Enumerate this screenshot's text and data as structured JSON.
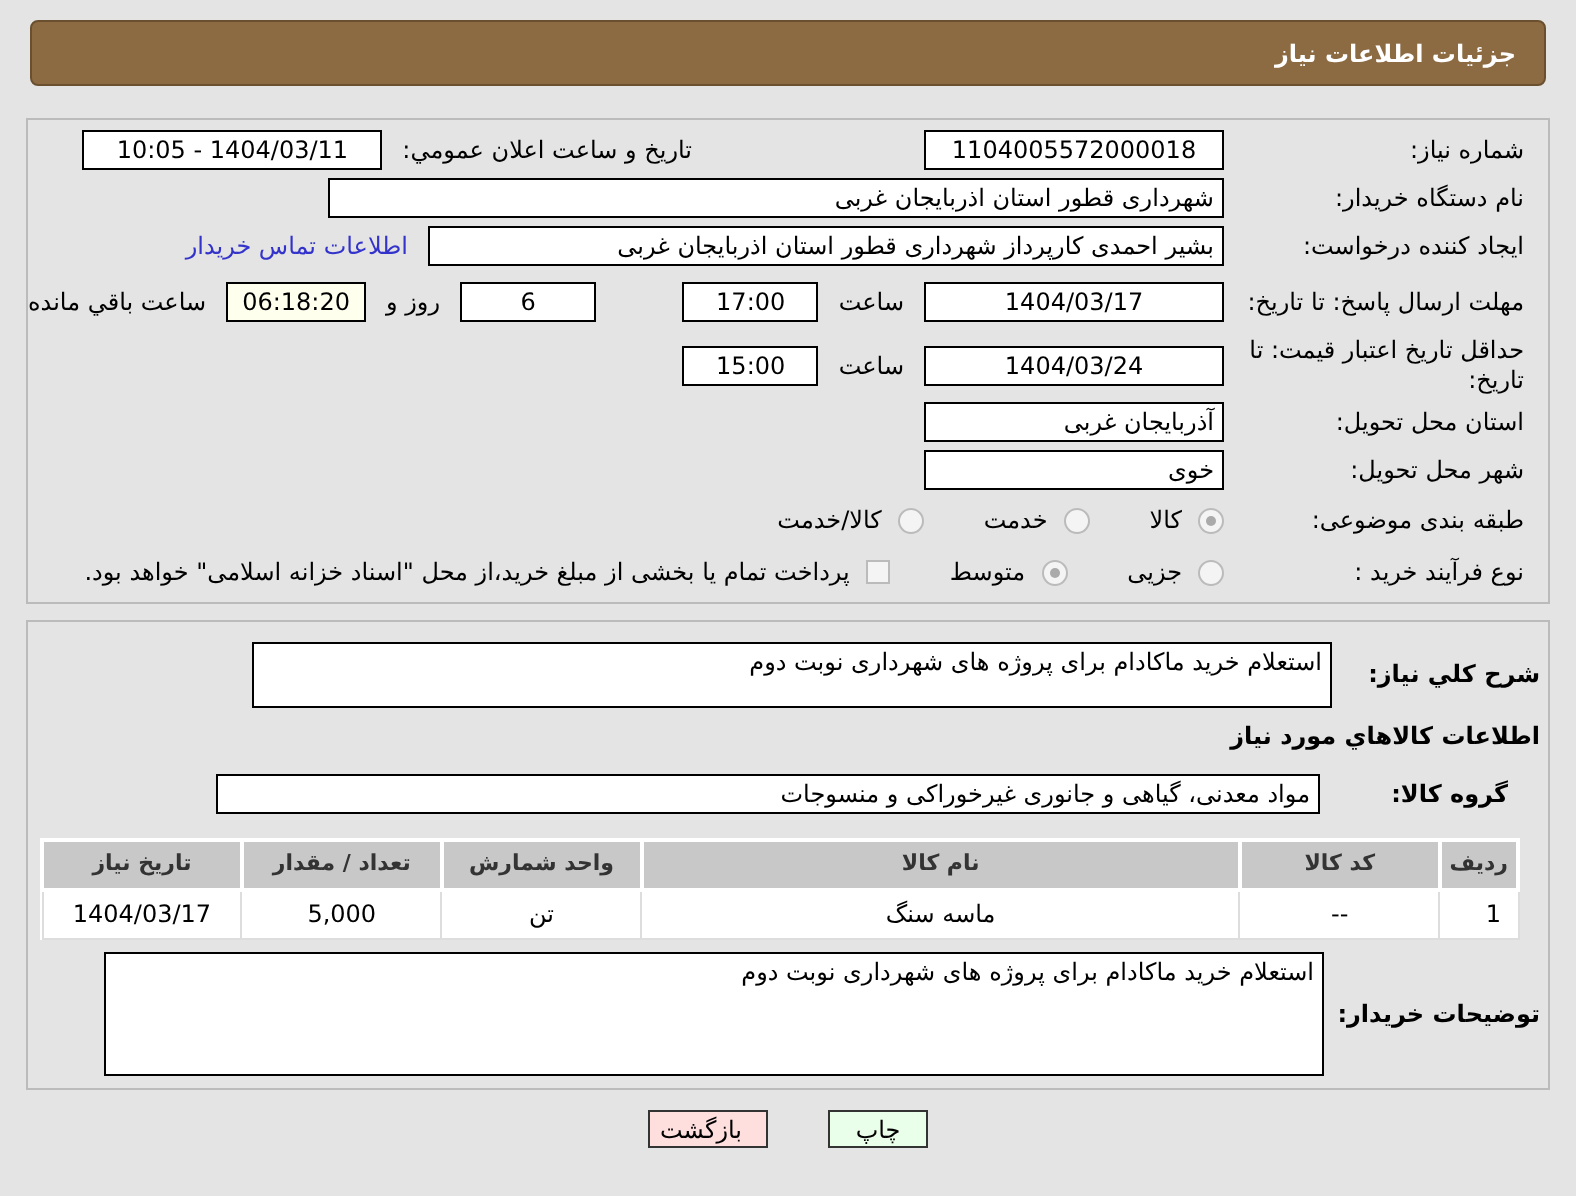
{
  "header": {
    "title": "جزئیات اطلاعات نیاز"
  },
  "need_number": {
    "label": "شماره نیاز:",
    "value": "1104005572000018"
  },
  "announce": {
    "label": "تاریخ و ساعت اعلان عمومي:",
    "value": "1404/03/11 - 10:05"
  },
  "buyer_org": {
    "label": "نام دستگاه خریدار:",
    "value": "شهرداری قطور استان اذربایجان غربی"
  },
  "requester": {
    "label": "ایجاد کننده درخواست:",
    "value": "بشیر احمدی کارپرداز شهرداری قطور استان اذربایجان غربی",
    "link": "اطلاعات تماس خریدار"
  },
  "deadline": {
    "label": "مهلت ارسال پاسخ: تا تاریخ:",
    "date": "1404/03/17",
    "time_label": "ساعت",
    "time": "17:00",
    "days": "6",
    "days_suffix": "روز و",
    "remaining": "06:18:20",
    "remaining_suffix": "ساعت باقي مانده"
  },
  "validity": {
    "label": "حداقل تاریخ اعتبار قیمت: تا تاریخ:",
    "date": "1404/03/24",
    "time_label": "ساعت",
    "time": "15:00"
  },
  "province": {
    "label": "استان محل تحویل:",
    "value": "آذربایجان غربی"
  },
  "city": {
    "label": "شهر محل تحویل:",
    "value": "خوی"
  },
  "category": {
    "label": "طبقه بندی موضوعی:",
    "options": [
      {
        "label": "کالا",
        "selected": true
      },
      {
        "label": "خدمت",
        "selected": false
      },
      {
        "label": "کالا/خدمت",
        "selected": false
      }
    ]
  },
  "process": {
    "label": "نوع فرآیند خرید :",
    "options": [
      {
        "label": "جزیی",
        "selected": false
      },
      {
        "label": "متوسط",
        "selected": true
      }
    ],
    "treasury": {
      "checked": false,
      "text": "پرداخت تمام یا بخشی از مبلغ خرید،از محل \"اسناد خزانه اسلامی\" خواهد بود."
    }
  },
  "description": {
    "label": "شرح کلي نیاز:",
    "value": "استعلام خرید ماکادام برای پروژه های شهرداری نوبت دوم"
  },
  "goods_heading": "اطلاعات کالاهاي مورد نياز",
  "goods_group": {
    "label": "گروه کالا:",
    "value": "مواد معدنی، گیاهی و جانوری غیرخوراکی و منسوجات"
  },
  "table": {
    "columns": [
      "ردیف",
      "کد کالا",
      "نام کالا",
      "واحد شمارش",
      "تعداد / مقدار",
      "تاریخ نیاز"
    ],
    "rows": [
      [
        "1",
        "--",
        "ماسه سنگ",
        "تن",
        "5,000",
        "1404/03/17"
      ]
    ]
  },
  "buyer_notes": {
    "label": "توضیحات خریدار:",
    "value": "استعلام خرید ماکادام برای پروژه های شهرداری نوبت دوم"
  },
  "buttons": [
    {
      "kind": "print",
      "label": "چاپ"
    },
    {
      "kind": "back",
      "label": "بازگشت"
    }
  ]
}
